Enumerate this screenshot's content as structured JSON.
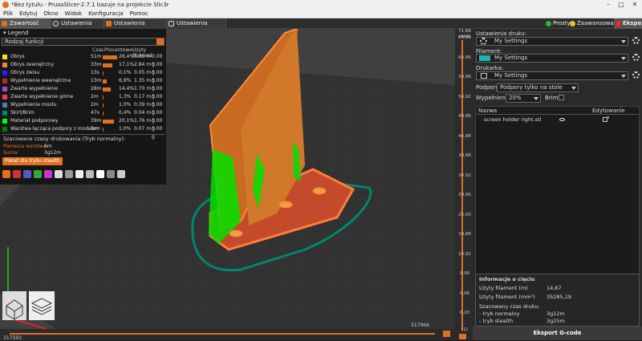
{
  "window": {
    "title": "*Bez tytułu - PrusaSlicer-2.7.1 bazuje na projekcie Slic3r",
    "minimize": "–",
    "maximize": "□",
    "close": "✕"
  },
  "menu": [
    "Plik",
    "Edytuj",
    "Okno",
    "Widok",
    "Konfiguracja",
    "Pomoc"
  ],
  "tabs": [
    {
      "label": "Zawartość Stołu",
      "icon": "plater-icon",
      "active": true
    },
    {
      "label": "Ustawienia Druku",
      "icon": "gear-icon",
      "active": false
    },
    {
      "label": "Ustawienia Filamentu",
      "icon": "spool-icon",
      "active": false
    },
    {
      "label": "Ustawienia Drukarki",
      "icon": "printer-icon",
      "active": false
    }
  ],
  "modes": [
    {
      "label": "Prosty",
      "color": "#2fb52f"
    },
    {
      "label": "Zaawansowane",
      "color": "#f0c020"
    },
    {
      "label": "Ekspert",
      "color": "#e03030",
      "active": true
    }
  ],
  "legend": {
    "header": "Legend",
    "combo": "Rodzaj funkcji",
    "col_time": "Czas",
    "col_percent": "Procentowo",
    "col_filament": "Użyty filament",
    "rows": [
      {
        "name": "Obrys",
        "color": "#ffe600",
        "time": "51m",
        "percent": "26,4%",
        "pfrac": 0.264,
        "meters": "6.38 m",
        "grams": "0.00 g"
      },
      {
        "name": "Obrys zewnętrzny",
        "color": "#ff7d38",
        "time": "33m",
        "percent": "17,1%",
        "pfrac": 0.171,
        "meters": "2.84 m",
        "grams": "0.00 g"
      },
      {
        "name": "Obrys zwisu",
        "color": "#1f1fff",
        "time": "13s",
        "percent": "0,1%",
        "pfrac": 0.001,
        "meters": "0.05 m",
        "grams": "0.00 g"
      },
      {
        "name": "Wypełnienie wewnętrzne",
        "color": "#b03029",
        "time": "13m",
        "percent": "6,9%",
        "pfrac": 0.069,
        "meters": "1.35 m",
        "grams": "0.00 g"
      },
      {
        "name": "Zwarte wypełnienie",
        "color": "#9654cc",
        "time": "28m",
        "percent": "14,4%",
        "pfrac": 0.144,
        "meters": "1.70 m",
        "grams": "0.00 g"
      },
      {
        "name": "Zwarte wypełnienie górne",
        "color": "#f04040",
        "time": "2m",
        "percent": "1,3%",
        "pfrac": 0.013,
        "meters": "0.17 m",
        "grams": "0.00 g"
      },
      {
        "name": "Wypełnienie mostu",
        "color": "#4d80ba",
        "time": "2m",
        "percent": "1,0%",
        "pfrac": 0.01,
        "meters": "0.39 m",
        "grams": "0.00 g"
      },
      {
        "name": "Skirt/Brim",
        "color": "#00876e",
        "time": "47s",
        "percent": "0,4%",
        "pfrac": 0.004,
        "meters": "0.04 m",
        "grams": "0.00 g"
      },
      {
        "name": "Materiał podporowy",
        "color": "#00ff00",
        "time": "39m",
        "percent": "20,1%",
        "pfrac": 0.201,
        "meters": "1.76 m",
        "grams": "0.00 g"
      },
      {
        "name": "Warstwa łącząca podpory z modelem",
        "color": "#008000",
        "time": "2m",
        "percent": "1,0%",
        "pfrac": 0.01,
        "meters": "0.07 m",
        "grams": "0.00 g"
      }
    ],
    "estimated_header": "Szacowane czasy drukowania (Tryb normalny):",
    "first_layer_label": "Pierwsza warstwa:",
    "first_layer_value": "6m",
    "total_label": "Suma:",
    "total_value": "3g12m",
    "stealth_button": "Pokaż dla trybu stealth"
  },
  "vertical_slider": {
    "top_value": "71,68",
    "top_layer": "(444)",
    "ticks": [
      "69,96",
      "64,96",
      "59,96",
      "54,92",
      "49,96",
      "44,88",
      "39,88",
      "34,92",
      "29,96",
      "25,00",
      "19,88",
      "14,92",
      "9,96",
      "4,96",
      "0,20"
    ],
    "bottom_layer": "(1)"
  },
  "horizontal_slider": {
    "left_value": "317593",
    "right_value": "317966"
  },
  "right_panel": {
    "print_settings_label": "Ustawienia druku:",
    "print_settings_value": "My Settings",
    "filament_label": "Filament:",
    "filament_value": "My Settings",
    "printer_label": "Drukarka:",
    "printer_value": "My Settings",
    "supports_label": "Podpory:",
    "supports_value": "Podpory tylko na stole",
    "infill_label": "Wypełnienie:",
    "infill_value": "20%",
    "brim_label": "Brim:",
    "col_name": "Nazwa",
    "col_edit": "Edytowanie",
    "object_name": "screen holder right.stl",
    "info_title": "Informacje o cięciu",
    "filament_m_label": "Użyty filament (m)",
    "filament_m_value": "14,67",
    "filament_mm3_label": "Użyty filament (mm³)",
    "filament_mm3_value": "35285,19",
    "est_label": "Szacowany czas druku:",
    "normal_label": "- tryb normalny",
    "normal_value": "3g12m",
    "stealth_label": "- tryb stealth",
    "stealth_value": "3g25m",
    "export_button": "Eksport G-code"
  }
}
